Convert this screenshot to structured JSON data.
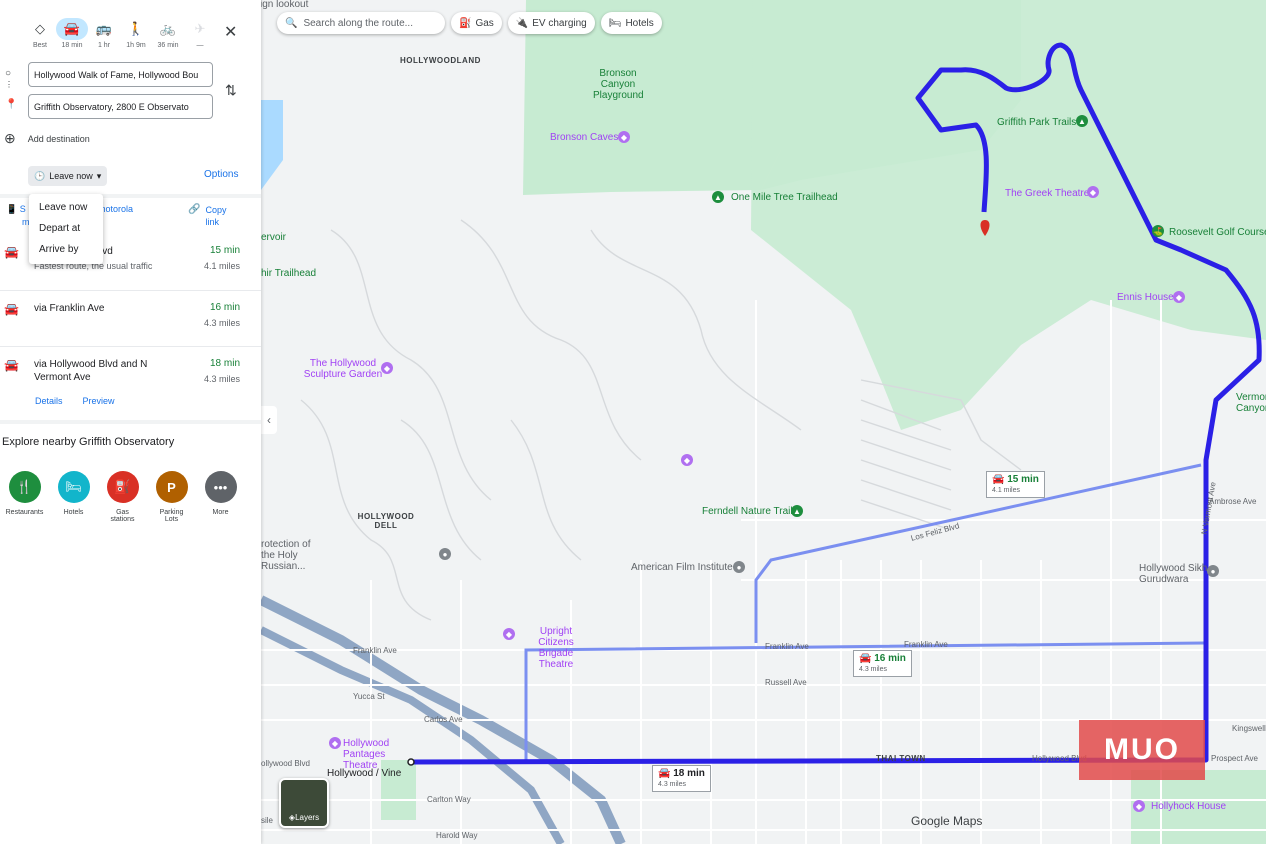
{
  "modes": [
    {
      "icon": "diamond-directions-icon",
      "label": "Best"
    },
    {
      "icon": "car-icon",
      "label": "18 min",
      "active": true
    },
    {
      "icon": "transit-icon",
      "label": "1 hr"
    },
    {
      "icon": "walk-icon",
      "label": "1h 9m"
    },
    {
      "icon": "bike-icon",
      "label": "36 min"
    },
    {
      "icon": "flight-icon",
      "label": "—"
    }
  ],
  "origin_value": "Hollywood Walk of Fame, Hollywood Bou",
  "destination_value": "Griffith Observatory, 2800 E Observato",
  "add_destination": "Add destination",
  "leave_now": "Leave now",
  "options": "Options",
  "dropdown": [
    "Leave now",
    "Depart at",
    "Arrive by"
  ],
  "send_partial_1": "S",
  "send_partial_2": "m",
  "send_partial_device": "motorola",
  "copy_link": "Copy link",
  "routes": [
    {
      "name": "lvd",
      "sub": "Fastest route, the usual traffic",
      "time": "15 min",
      "miles": "4.1 miles"
    },
    {
      "name": "via Franklin Ave",
      "sub": "",
      "time": "16 min",
      "miles": "4.3 miles"
    },
    {
      "name": "via Hollywood Blvd and N Vermont Ave",
      "sub": "",
      "time": "18 min",
      "miles": "4.3 miles"
    }
  ],
  "details": "Details",
  "preview": "Preview",
  "explore_title": "Explore nearby Griffith Observatory",
  "explore": [
    {
      "label": "Restaurants",
      "color": "#1e8e3e",
      "icon": "fork-knife-icon"
    },
    {
      "label": "Hotels",
      "color": "#12b5cb",
      "icon": "bed-icon"
    },
    {
      "label": "Gas stations",
      "color": "#d93025",
      "icon": "gas-pump-icon"
    },
    {
      "label": "Parking Lots",
      "color": "#b06000",
      "icon": "parking-icon"
    },
    {
      "label": "More",
      "color": "#5f6368",
      "icon": "more-icon"
    }
  ],
  "map": {
    "search_placeholder": "Search along the route...",
    "chip_gas": "Gas",
    "chip_ev": "EV charging",
    "chip_hotels": "Hotels",
    "labels": {
      "hollywoodland": "HOLLYWOODLAND",
      "bronson_canyon": "Bronson Canyon Playground",
      "bronson_caves": "Bronson Caves",
      "griffith_trails": "Griffith Park Trails",
      "greek_theatre": "The Greek Theatre",
      "roosevelt_golf": "Roosevelt Golf Course",
      "one_mile": "One Mile Tree Trailhead",
      "ennis_house": "Ennis House",
      "sculpture_garden": "The Hollywood Sculpture Garden",
      "hollywood_dell": "HOLLYWOOD DELL",
      "fern_dell": "Ferndell Nature Trail",
      "afi": "American Film Institute",
      "ucb": "Upright Citizens Brigade Theatre",
      "pantages": "Hollywood Pantages Theatre",
      "hollywood_vine": "Hollywood / Vine",
      "thai_town": "THAI TOWN",
      "hollywood_sikh": "Hollywood Sikh Gurudwara",
      "hollyhock": "Hollyhock House",
      "vermont_canyon": "Vermont Canyon",
      "sign_lookout": "sign lookout",
      "ervoir": "ervoir",
      "hir_trailhead": "hir Trailhead",
      "rotection": "rotection of the Holy Russian...",
      "ollywood_blvd": "ollywood Blvd",
      "franklin_ave": "Franklin Ave",
      "franklin_ave2": "Franklin Ave",
      "russell_ave": "Russell Ave",
      "yucca_st": "Yucca St",
      "carlos_ave": "Carlos Ave",
      "prospect_ave": "Prospect Ave",
      "ambrose_ave": "Ambrose Ave",
      "kingswell": "Kingswell A",
      "los_feliz": "Los Feliz Blvd",
      "hollywood_blvd_label": "Hollywood Blvd",
      "n_vermont": "N Vermont Ave",
      "sile": "sile",
      "carlton_way": "Carlton Way",
      "harold_way": "Harold Way"
    },
    "route_boxes": [
      {
        "time": "15 min",
        "miles": "4.1 miles"
      },
      {
        "time": "16 min",
        "miles": "4.3 miles"
      },
      {
        "time": "18 min",
        "miles": "4.3 miles"
      }
    ],
    "layers": "Layers",
    "watermark": "MUO",
    "logo": "Google Maps",
    "colors": {
      "route": "#2b20e6",
      "alt_route": "#7b8ff0",
      "park": "#c7ebd2",
      "water": "#aadaff"
    }
  }
}
